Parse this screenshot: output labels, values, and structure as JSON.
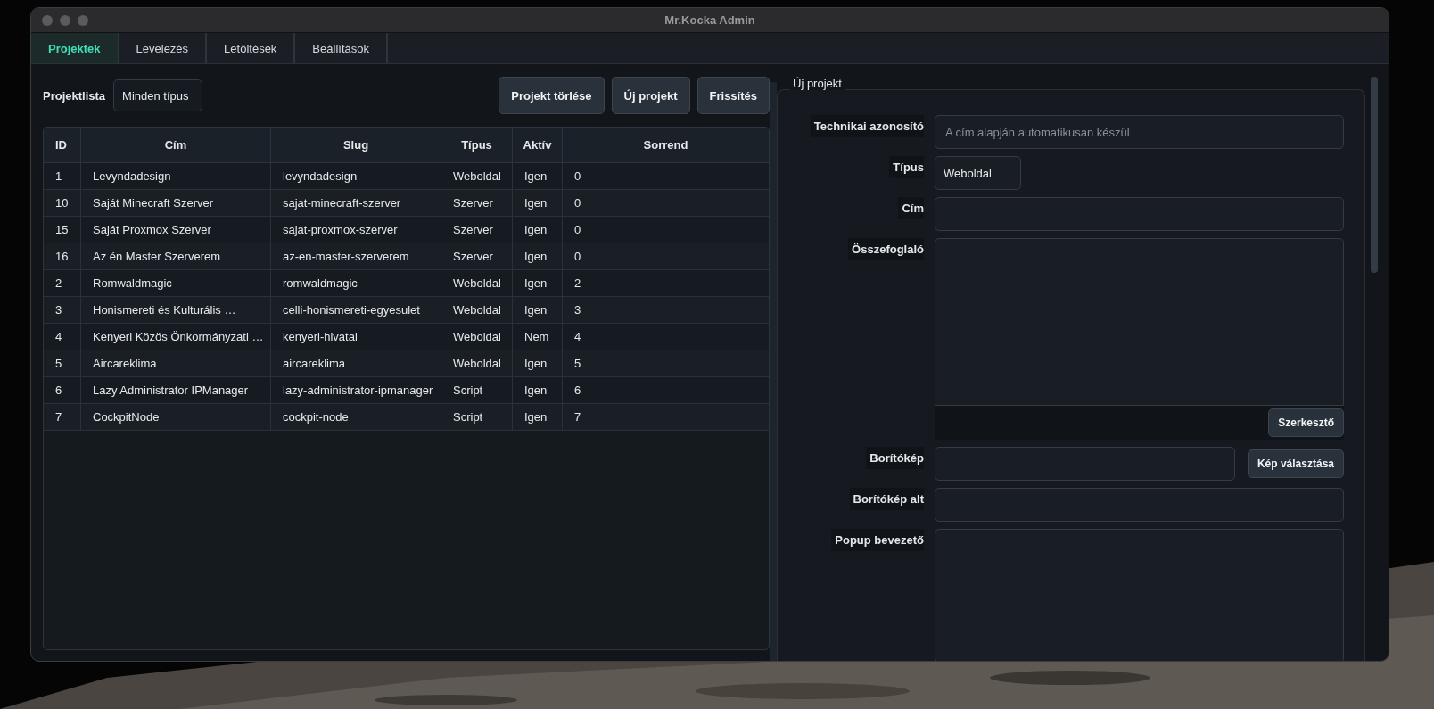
{
  "window": {
    "title": "Mr.Kocka Admin"
  },
  "tabs": [
    {
      "label": "Projektek",
      "selected": true
    },
    {
      "label": "Levelezés",
      "selected": false
    },
    {
      "label": "Letöltések",
      "selected": false
    },
    {
      "label": "Beállítások",
      "selected": false
    }
  ],
  "toolbar": {
    "label": "Projektlista",
    "type_filter": "Minden típus",
    "buttons": [
      "Projekt törlése",
      "Új projekt",
      "Frissítés"
    ]
  },
  "table": {
    "columns": [
      "ID",
      "Cím",
      "Slug",
      "Típus",
      "Aktív",
      "Sorrend"
    ],
    "rows": [
      [
        "1",
        "Levyndadesign",
        "levyndadesign",
        "Weboldal",
        "Igen",
        "0"
      ],
      [
        "10",
        "Saját Minecraft Szerver",
        "sajat-minecraft-szerver",
        "Szerver",
        "Igen",
        "0"
      ],
      [
        "15",
        "Saját Proxmox Szerver",
        "sajat-proxmox-szerver",
        "Szerver",
        "Igen",
        "0"
      ],
      [
        "16",
        "Az én Master Szerverem",
        "az-en-master-szerverem",
        "Szerver",
        "Igen",
        "0"
      ],
      [
        "2",
        "Romwaldmagic",
        "romwaldmagic",
        "Weboldal",
        "Igen",
        "2"
      ],
      [
        "3",
        "Honismereti és Kulturális …",
        "celli-honismereti-egyesulet",
        "Weboldal",
        "Igen",
        "3"
      ],
      [
        "4",
        "Kenyeri Közös Önkormányzati …",
        "kenyeri-hivatal",
        "Weboldal",
        "Nem",
        "4"
      ],
      [
        "5",
        "Aircareklima",
        "aircareklima",
        "Weboldal",
        "Igen",
        "5"
      ],
      [
        "6",
        "Lazy Administrator IPManager",
        "lazy-administrator-ipmanager",
        "Script",
        "Igen",
        "6"
      ],
      [
        "7",
        "CockpitNode",
        "cockpit-node",
        "Script",
        "Igen",
        "7"
      ]
    ]
  },
  "form": {
    "title": "Új projekt",
    "fields": [
      {
        "kind": "input",
        "label": "Technikai azonosító",
        "placeholder": "A cím alapján automatikusan készül"
      },
      {
        "kind": "select",
        "label": "Típus",
        "value": "Weboldal"
      },
      {
        "kind": "input",
        "label": "Cím"
      },
      {
        "kind": "textarea",
        "label": "Összefoglaló",
        "button": "Szerkesztő"
      },
      {
        "kind": "file",
        "label": "Borítókép",
        "button": "Kép választása"
      },
      {
        "kind": "input",
        "label": "Borítókép alt"
      },
      {
        "kind": "textarea",
        "label": "Popup bevezető"
      }
    ]
  }
}
